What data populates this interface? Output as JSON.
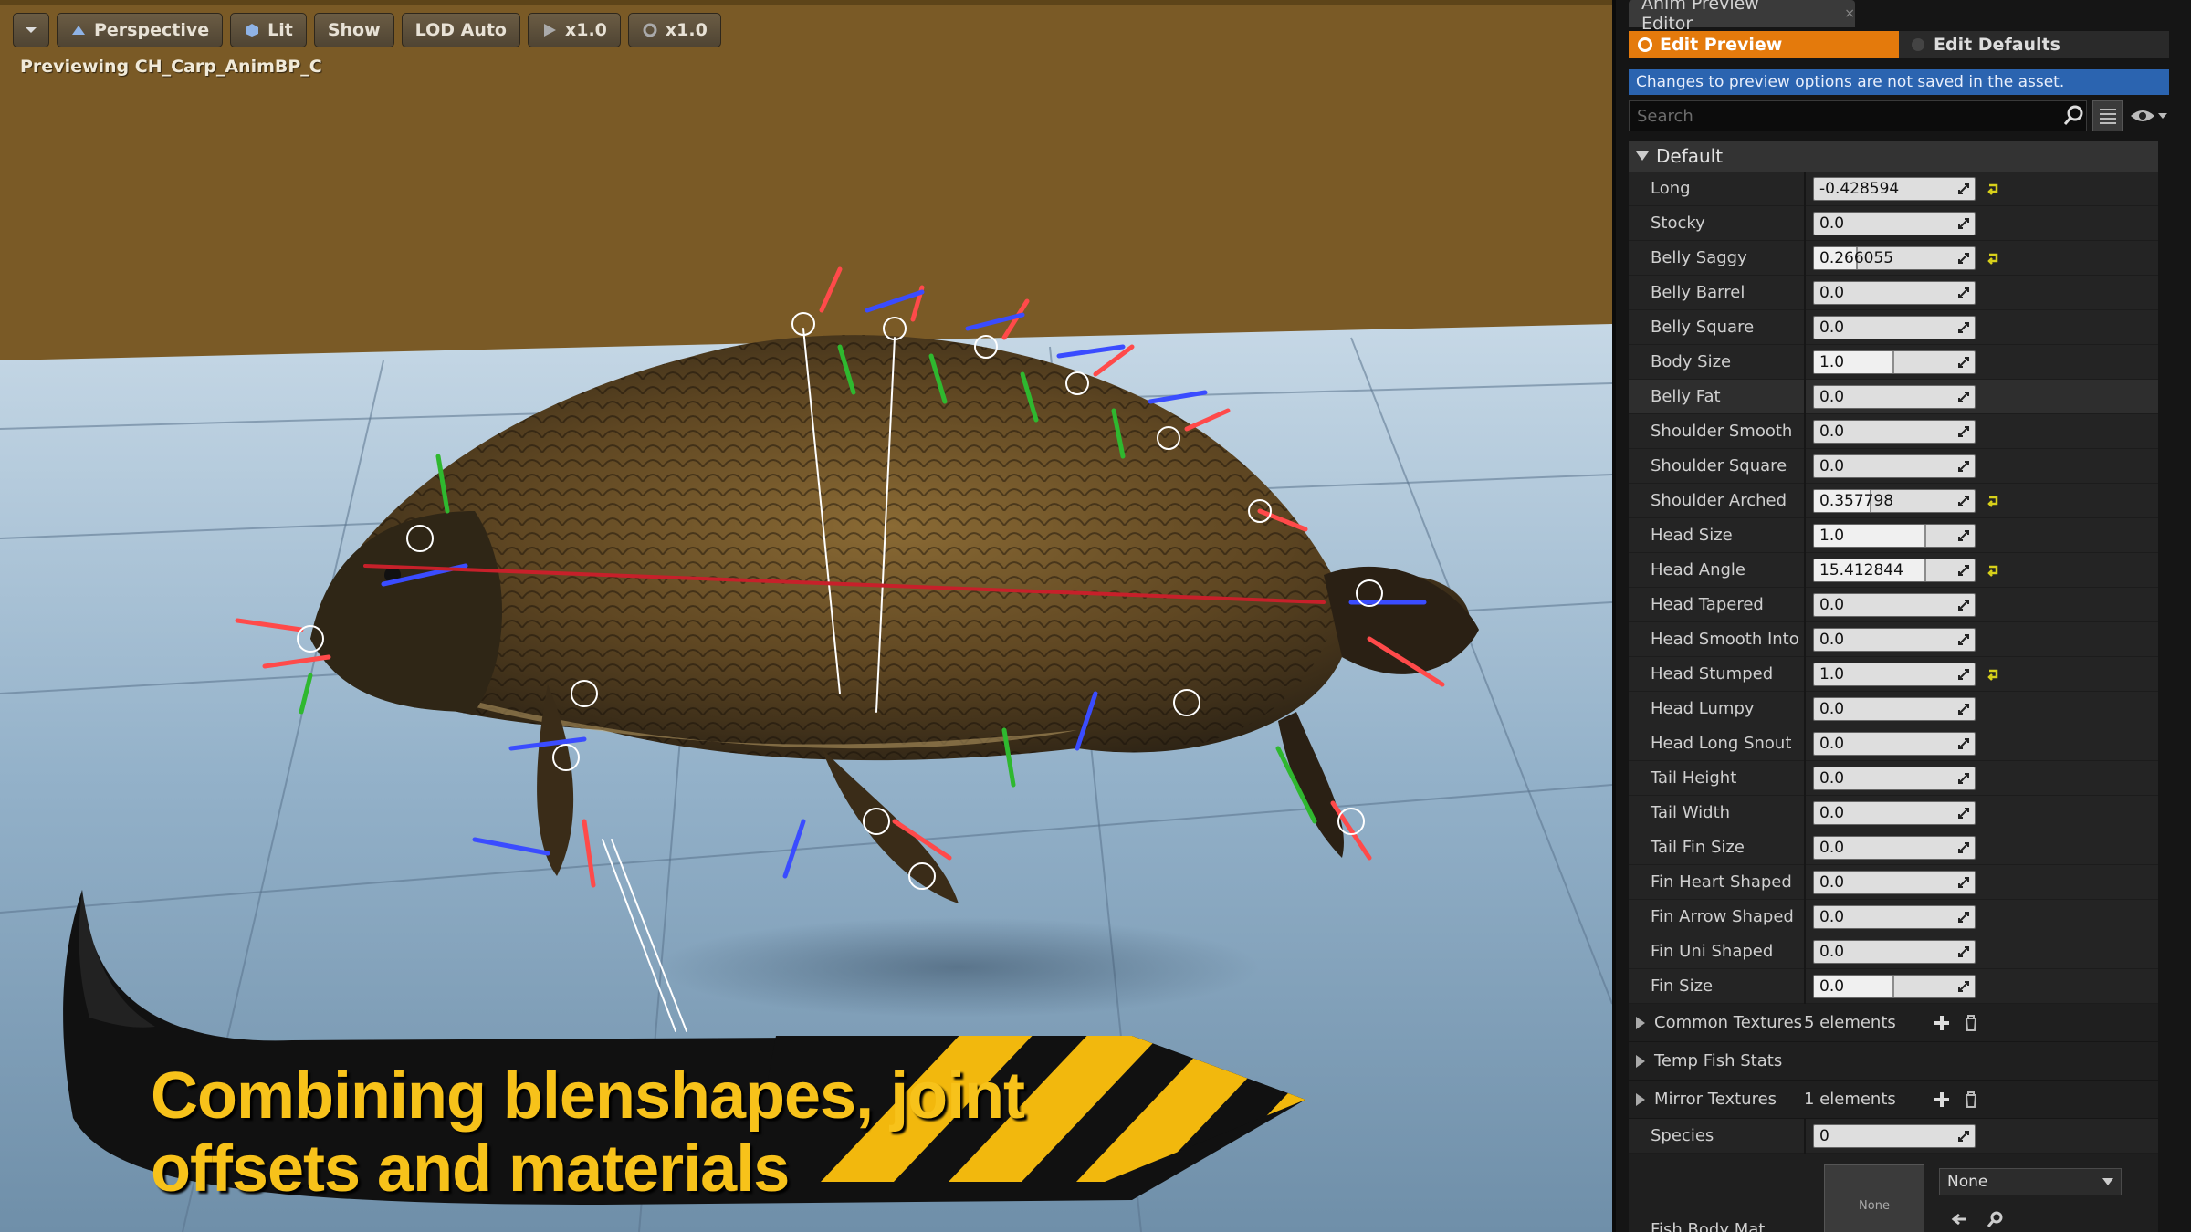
{
  "viewport": {
    "toolbar": {
      "menu_label": "",
      "perspective_label": "Perspective",
      "lit_label": "Lit",
      "show_label": "Show",
      "lod_label": "LOD Auto",
      "play_rate_label": "x1.0",
      "turn_rate_label": "x1.0"
    },
    "preview_label": "Previewing CH_Carp_AnimBP_C",
    "banner": {
      "line1": "Combining blenshapes, joint",
      "line2": "offsets and materials"
    },
    "colors": {
      "sky": "#7a5a26",
      "floor": "#9ab8cf",
      "banner_text": "#f7c21a",
      "hazard_yellow": "#f2b80d"
    }
  },
  "panel": {
    "tab_title": "Anim Preview Editor",
    "tab_close": "×",
    "mode_edit_preview": "Edit Preview",
    "mode_edit_defaults": "Edit Defaults",
    "notice": "Changes to preview options are not saved in the asset.",
    "search": {
      "placeholder": "Search"
    },
    "section_title": "Default",
    "properties": [
      {
        "name": "Long",
        "value": "-0.428594",
        "fill": 0,
        "modified": true
      },
      {
        "name": "Stocky",
        "value": "0.0",
        "fill": 0,
        "modified": false
      },
      {
        "name": "Belly Saggy",
        "value": "0.266055",
        "fill": 0.27,
        "modified": true
      },
      {
        "name": "Belly Barrel",
        "value": "0.0",
        "fill": 0,
        "modified": false
      },
      {
        "name": "Belly Square",
        "value": "0.0",
        "fill": 0,
        "modified": false
      },
      {
        "name": "Body Size",
        "value": "1.0",
        "fill": 0.5,
        "modified": false
      },
      {
        "name": "Belly Fat",
        "value": "0.0",
        "fill": 0,
        "modified": false
      },
      {
        "name": "Shoulder Smooth",
        "value": "0.0",
        "fill": 0,
        "modified": false
      },
      {
        "name": "Shoulder Square",
        "value": "0.0",
        "fill": 0,
        "modified": false
      },
      {
        "name": "Shoulder Arched",
        "value": "0.357798",
        "fill": 0.36,
        "modified": true
      },
      {
        "name": "Head Size",
        "value": "1.0",
        "fill": 0.7,
        "modified": false
      },
      {
        "name": "Head Angle",
        "value": "15.412844",
        "fill": 0.7,
        "modified": true
      },
      {
        "name": "Head Tapered",
        "value": "0.0",
        "fill": 0,
        "modified": false
      },
      {
        "name": "Head Smooth Into S",
        "value": "0.0",
        "fill": 0,
        "modified": false
      },
      {
        "name": "Head Stumped",
        "value": "1.0",
        "fill": 0,
        "modified": true
      },
      {
        "name": "Head Lumpy",
        "value": "0.0",
        "fill": 0,
        "modified": false
      },
      {
        "name": "Head Long Snout",
        "value": "0.0",
        "fill": 0,
        "modified": false
      },
      {
        "name": "Tail Height",
        "value": "0.0",
        "fill": 0,
        "modified": false
      },
      {
        "name": "Tail Width",
        "value": "0.0",
        "fill": 0,
        "modified": false
      },
      {
        "name": "Tail Fin Size",
        "value": "0.0",
        "fill": 0,
        "modified": false
      },
      {
        "name": "Fin Heart Shaped",
        "value": "0.0",
        "fill": 0,
        "modified": false
      },
      {
        "name": "Fin Arrow Shaped",
        "value": "0.0",
        "fill": 0,
        "modified": false
      },
      {
        "name": "Fin Uni Shaped",
        "value": "0.0",
        "fill": 0,
        "modified": false
      },
      {
        "name": "Fin Size",
        "value": "0.0",
        "fill": 0.5,
        "modified": false
      }
    ],
    "groups": [
      {
        "name": "Common Textures",
        "value": "5 elements",
        "has_buttons": true
      },
      {
        "name": "Temp Fish Stats",
        "value": "",
        "has_buttons": false
      },
      {
        "name": "Mirror Textures",
        "value": "1 elements",
        "has_buttons": true
      }
    ],
    "species": {
      "name": "Species",
      "value": "0"
    },
    "fish_body_mat": {
      "name": "Fish Body Mat",
      "thumb": "None",
      "selected": "None"
    },
    "colors": {
      "accent": "#e47a0c",
      "notice_bg": "#2b64b0",
      "reset_arrow": "#d8d11a"
    }
  }
}
